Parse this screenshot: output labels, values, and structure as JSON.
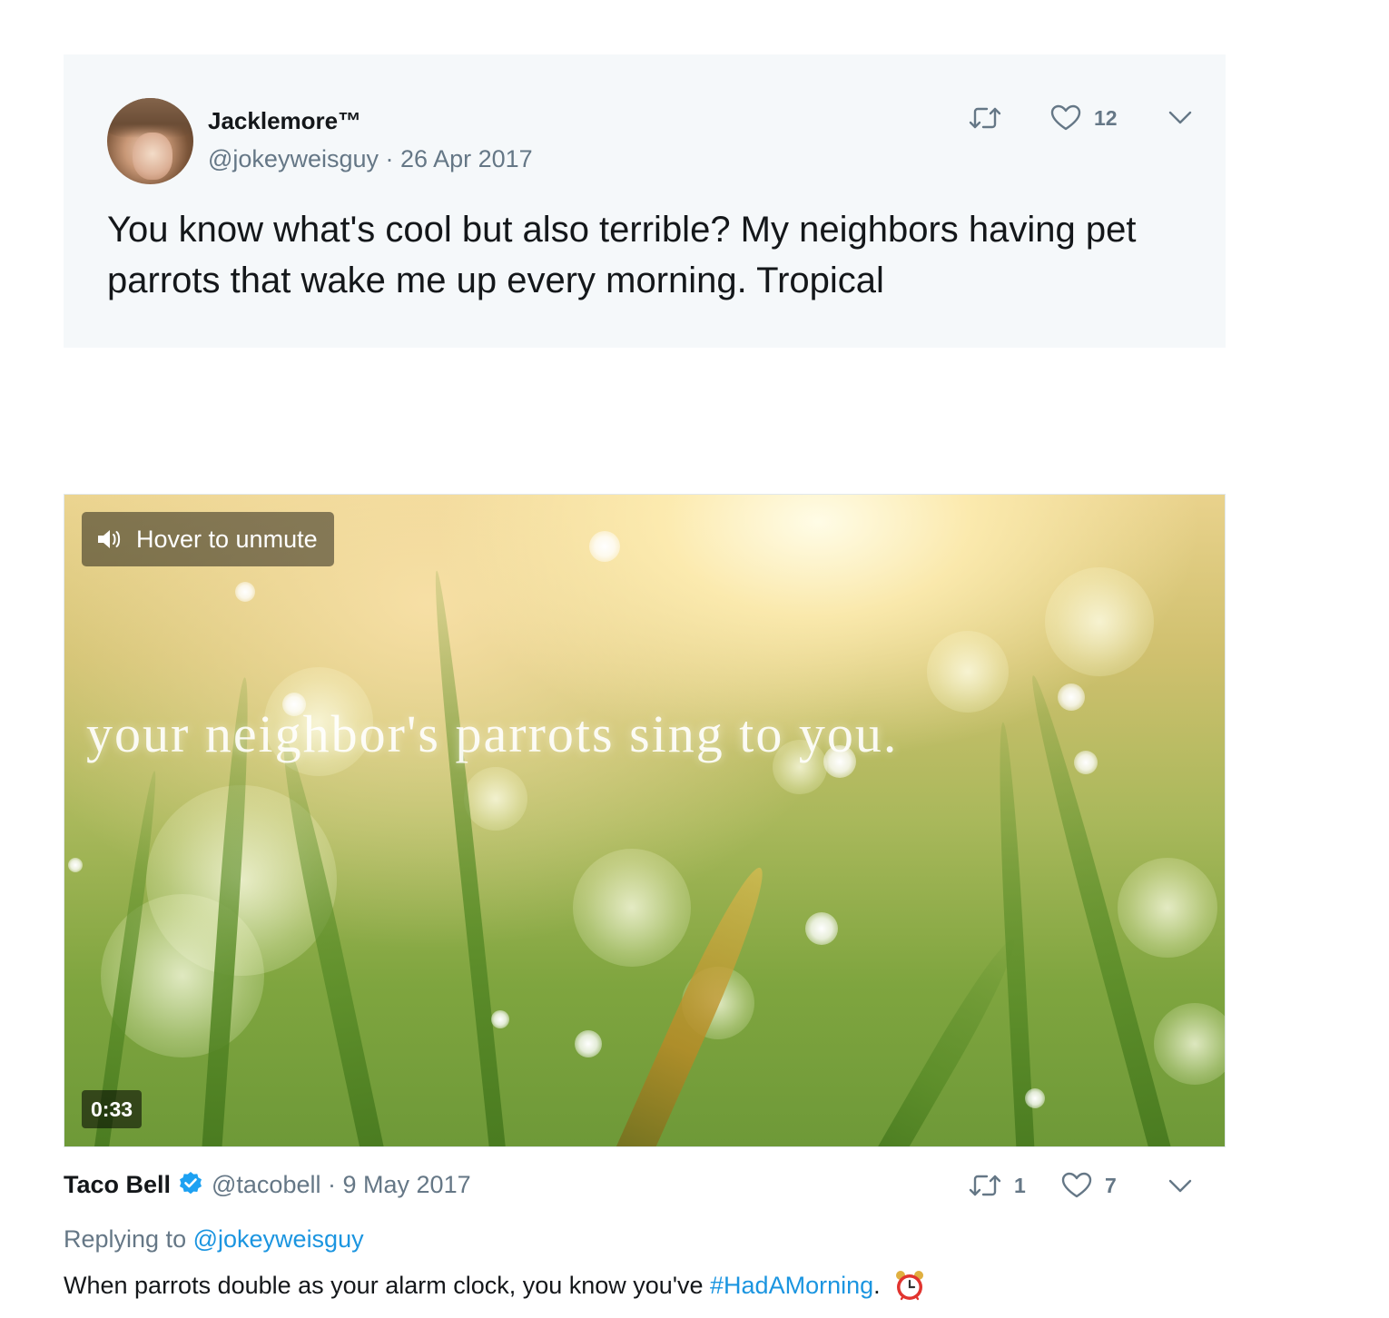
{
  "quoted_tweet": {
    "display_name": "Jacklemore™",
    "handle": "@jokeyweisguy",
    "separator": "·",
    "date": "26 Apr 2017",
    "text": "You know what's cool but also terrible? My neighbors having pet parrots that wake me up every morning. Tropical",
    "like_count": "12",
    "icons": {
      "retweet": "retweet-icon",
      "like": "heart-icon",
      "more": "chevron-down-icon"
    }
  },
  "video": {
    "overlay_text": "your neighbor's parrots sing to you.",
    "unmute_label": "Hover to unmute",
    "duration": "0:33",
    "icons": {
      "unmute": "speaker-icon"
    }
  },
  "reply_tweet": {
    "display_name": "Taco Bell",
    "verified": true,
    "handle": "@tacobell",
    "separator": "·",
    "date": "9 May 2017",
    "retweet_count": "1",
    "like_count": "7",
    "replying_prefix": "Replying to",
    "replying_handle": "@jokeyweisguy",
    "text_before": "When parrots double as your alarm clock, you know you've",
    "hashtag": "#HadAMorning",
    "text_after": ".",
    "icons": {
      "verified": "verified-badge-icon",
      "emoji": "alarm-clock-icon"
    }
  },
  "colors": {
    "card_background": "#f5f8fa",
    "secondary_text": "#657786",
    "link": "#1b95e0",
    "primary_text": "#14171a",
    "verified_blue": "#1da1f2"
  }
}
